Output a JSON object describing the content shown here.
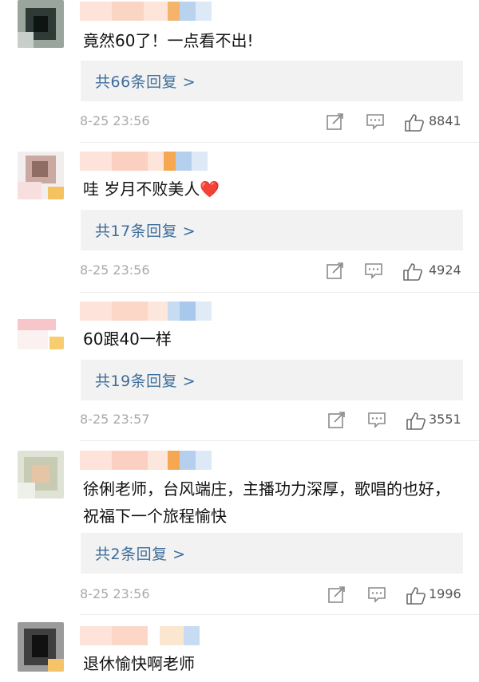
{
  "comments": [
    {
      "text": "竟然60了！一点看不出!",
      "replies": "共66条回复 >",
      "time": "8-25 23:56",
      "likes": "8841",
      "icons": [
        "share-icon",
        "comment-icon",
        "thumbs-up-icon"
      ]
    },
    {
      "text": "哇 岁月不败美人",
      "emoji": "❤️",
      "replies": "共17条回复 >",
      "time": "8-25 23:56",
      "likes": "4924",
      "icons": [
        "share-icon",
        "comment-icon",
        "thumbs-up-icon"
      ]
    },
    {
      "text": "60跟40一样",
      "replies": "共19条回复 >",
      "time": "8-25 23:57",
      "likes": "3551",
      "icons": [
        "share-icon",
        "comment-icon",
        "thumbs-up-icon"
      ]
    },
    {
      "text": "徐俐老师，台风端庄，主播功力深厚，歌唱的也好，祝福下一个旅程愉快",
      "replies": "共2条回复 >",
      "time": "8-25 23:56",
      "likes": "1996",
      "icons": [
        "share-icon",
        "comment-icon",
        "thumbs-up-icon"
      ]
    },
    {
      "text": "退休愉快啊老师"
    }
  ],
  "colors": {
    "reply_link": "#3d6d9a",
    "reply_bg": "#f2f2f2",
    "timestamp": "#a9a9a9",
    "heart": "#e0302b"
  }
}
